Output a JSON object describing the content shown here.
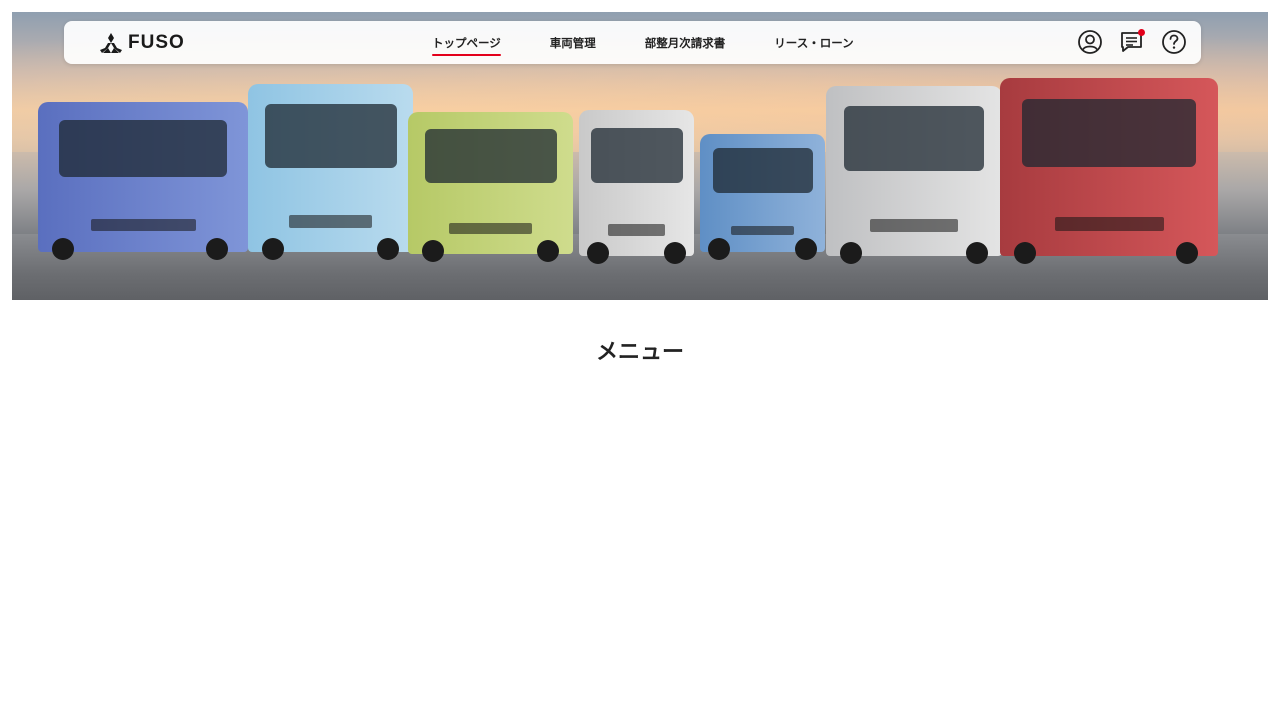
{
  "brand": {
    "name": "FUSO",
    "logo_icon": "mitsubishi-diamond-icon"
  },
  "nav": {
    "items": [
      {
        "label": "トップページ",
        "active": true
      },
      {
        "label": "車両管理",
        "active": false
      },
      {
        "label": "部整月次請求書",
        "active": false
      },
      {
        "label": "リース・ローン",
        "active": false
      }
    ],
    "icons": [
      {
        "name": "account-icon"
      },
      {
        "name": "messages-icon",
        "has_notification": true
      },
      {
        "name": "help-icon"
      }
    ]
  },
  "hero": {
    "image": "vehicle-lineup-banner"
  },
  "main": {
    "heading": "メニュー"
  },
  "colors": {
    "accent": "#e3001b",
    "text": "#222222",
    "background": "#ffffff"
  }
}
